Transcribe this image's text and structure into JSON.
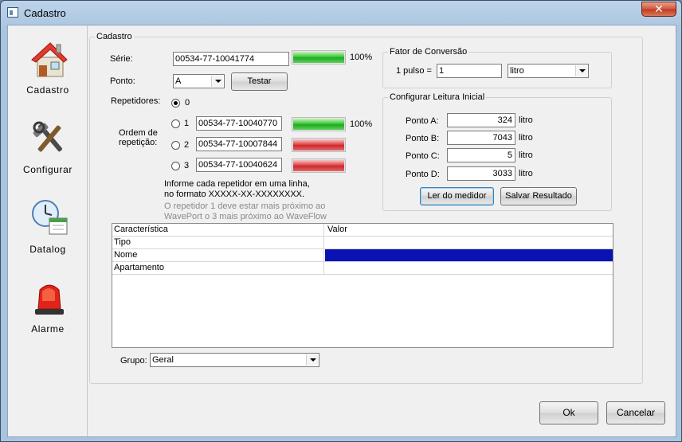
{
  "window": {
    "title": "Cadastro",
    "close_glyph": "✕"
  },
  "sidebar": {
    "items": [
      {
        "label": "Cadastro",
        "icon": "house-icon"
      },
      {
        "label": "Configurar",
        "icon": "tools-icon"
      },
      {
        "label": "Datalog",
        "icon": "clock-calendar-icon"
      },
      {
        "label": "Alarme",
        "icon": "siren-icon"
      }
    ]
  },
  "cadastro": {
    "group_label": "Cadastro",
    "serie_label": "Série:",
    "serie_value": "00534-77-10041774",
    "serie_signal": "100%",
    "ponto_label": "Ponto:",
    "ponto_value": "A",
    "testar_label": "Testar",
    "repetidores_label": "Repetidores:",
    "rep0_label": "0",
    "ordem_label_1": "Ordem de",
    "ordem_label_2": "repetição:",
    "repeaters": [
      {
        "num": "1",
        "value": "00534-77-10040770",
        "signal": "100%",
        "status": "green"
      },
      {
        "num": "2",
        "value": "00534-77-10007844",
        "signal": "",
        "status": "red"
      },
      {
        "num": "3",
        "value": "00534-77-10040624",
        "signal": "",
        "status": "red"
      }
    ],
    "hint_1": "Informe cada repetidor em uma linha,",
    "hint_2": "no formato XXXXX-XX-XXXXXXXX.",
    "hint_3": "O repetidor 1 deve estar mais próximo ao",
    "hint_4": "WavePort o 3 mais próximo ao WaveFlow"
  },
  "fator": {
    "group_label": "Fator de Conversão",
    "pulso_label": "1 pulso =",
    "pulso_value": "1",
    "unit_value": "litro"
  },
  "leitura": {
    "group_label": "Configurar Leitura Inicial",
    "rows": [
      {
        "label": "Ponto A:",
        "value": "324",
        "unit": "litro"
      },
      {
        "label": "Ponto B:",
        "value": "7043",
        "unit": "litro"
      },
      {
        "label": "Ponto C:",
        "value": "5",
        "unit": "litro"
      },
      {
        "label": "Ponto D:",
        "value": "3033",
        "unit": "litro"
      }
    ],
    "ler_label": "Ler do medidor",
    "salvar_label": "Salvar Resultado"
  },
  "grid": {
    "col1": "Característica",
    "col2": "Valor",
    "rows": [
      {
        "name": "Tipo",
        "value": ""
      },
      {
        "name": "Nome",
        "value": ""
      },
      {
        "name": "Apartamento",
        "value": ""
      }
    ]
  },
  "grupo": {
    "label": "Grupo:",
    "value": "Geral"
  },
  "footer": {
    "ok_label": "Ok",
    "cancel_label": "Cancelar"
  },
  "colors": {
    "accent_selected": "#0a12b4",
    "signal_good": "#1faa1f",
    "signal_bad": "#cc2a2c"
  }
}
